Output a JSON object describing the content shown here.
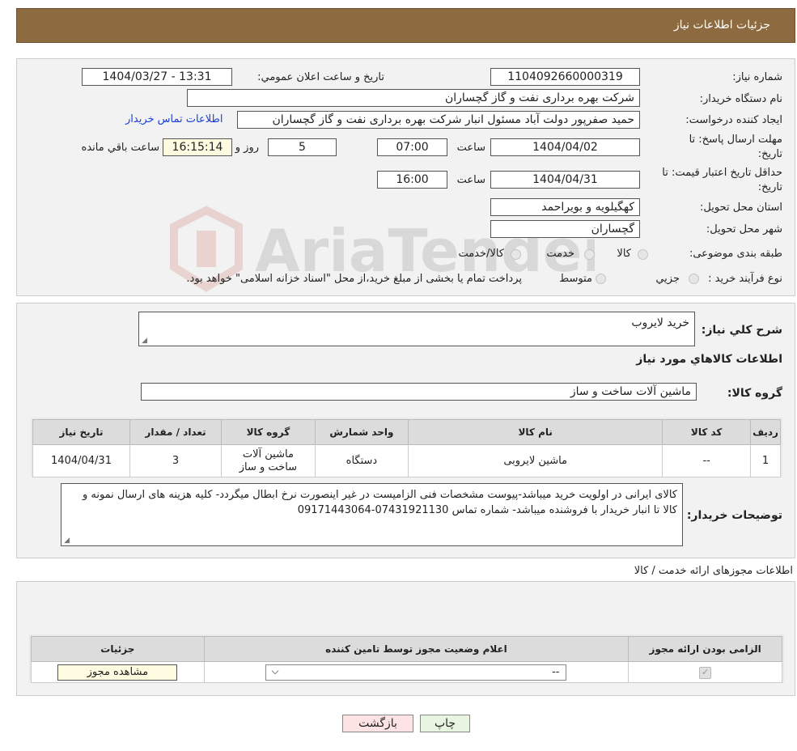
{
  "header": {
    "title": "جزئیات اطلاعات نیاز"
  },
  "info": {
    "need_number_label": "شماره نیاز:",
    "need_number": "1104092660000319",
    "announce_label": "تاریخ و ساعت اعلان عمومي:",
    "announce_value": "1404/03/27 - 13:31",
    "buyer_org_label": "نام دستگاه خریدار:",
    "buyer_org": "شرکت بهره برداری نفت و گاز گچساران",
    "creator_label": "ایجاد کننده درخواست:",
    "creator": "حمید  صفرپور دولت آباد مسئول انبار شرکت بهره برداری نفت و گاز گچساران",
    "contact_link": "اطلاعات تماس خریدار",
    "deadline_label_1": "مهلت ارسال پاسخ: تا",
    "deadline_label_2": "تاریخ:",
    "deadline_date": "1404/04/02",
    "time_label": "ساعت",
    "deadline_time": "07:00",
    "days_value": "5",
    "days_label": "روز و",
    "remaining_time": "16:15:14",
    "remaining_label": "ساعت باقي مانده",
    "validity_label_1": "حداقل تاریخ اعتبار قیمت: تا",
    "validity_label_2": "تاریخ:",
    "validity_date": "1404/04/31",
    "validity_time": "16:00",
    "province_label": "استان محل تحویل:",
    "province": "کهگیلویه و بویراحمد",
    "city_label": "شهر محل تحویل:",
    "city": "گچساران",
    "category_label": "طبقه بندی موضوعی:",
    "category_options": [
      "کالا",
      "خدمت",
      "کالا/خدمت"
    ],
    "process_label": "نوع فرآیند خرید :",
    "process_options": [
      "جزیي",
      "متوسط"
    ],
    "process_note": "پرداخت تمام یا بخشی از مبلغ خرید،از محل \"اسناد خزانه اسلامی\" خواهد بود."
  },
  "description": {
    "label": "شرح کلي نیاز:",
    "value": "خرید لایروب",
    "items_title": "اطلاعات کالاهاي مورد نیاز",
    "group_label": "گروه کالا:",
    "group_value": "ماشین آلات ساخت و ساز"
  },
  "items_table": {
    "headers": [
      "ردیف",
      "کد کالا",
      "نام کالا",
      "واحد شمارش",
      "گروه کالا",
      "تعداد / مقدار",
      "تاریخ نیاز"
    ],
    "rows": [
      [
        "1",
        "--",
        "ماشین لایروبی",
        "دستگاه",
        "ماشین آلات ساخت و ساز",
        "3",
        "1404/04/31"
      ]
    ]
  },
  "buyer_notes": {
    "label": "توضیحات خریدار:",
    "text": "کالای ایرانی در اولویت خرید میباشد-پیوست مشخصات فنی الزامیست در غیر اینصورت نرخ ابطال میگردد- کلیه هزینه های ارسال نمونه و  کالا  تا انبار خریدار با فروشنده میباشد- شماره تماس 07431921130-09171443064"
  },
  "permits": {
    "title": "اطلاعات مجوزهای ارائه خدمت / کالا",
    "headers": [
      "الزامی بودن ارائه مجوز",
      "اعلام وضعیت مجوز توسط تامین کننده",
      "جزئیات"
    ],
    "select_value": "--",
    "view_button": "مشاهده مجوز"
  },
  "actions": {
    "print": "چاپ",
    "back": "بازگشت"
  },
  "watermark": "AriaTender.neT",
  "colors": {
    "header_bg": "#8d6a3f",
    "link": "#1a3fd6",
    "back_btn": "#fde3e3",
    "print_btn": "#e8f5e0"
  }
}
